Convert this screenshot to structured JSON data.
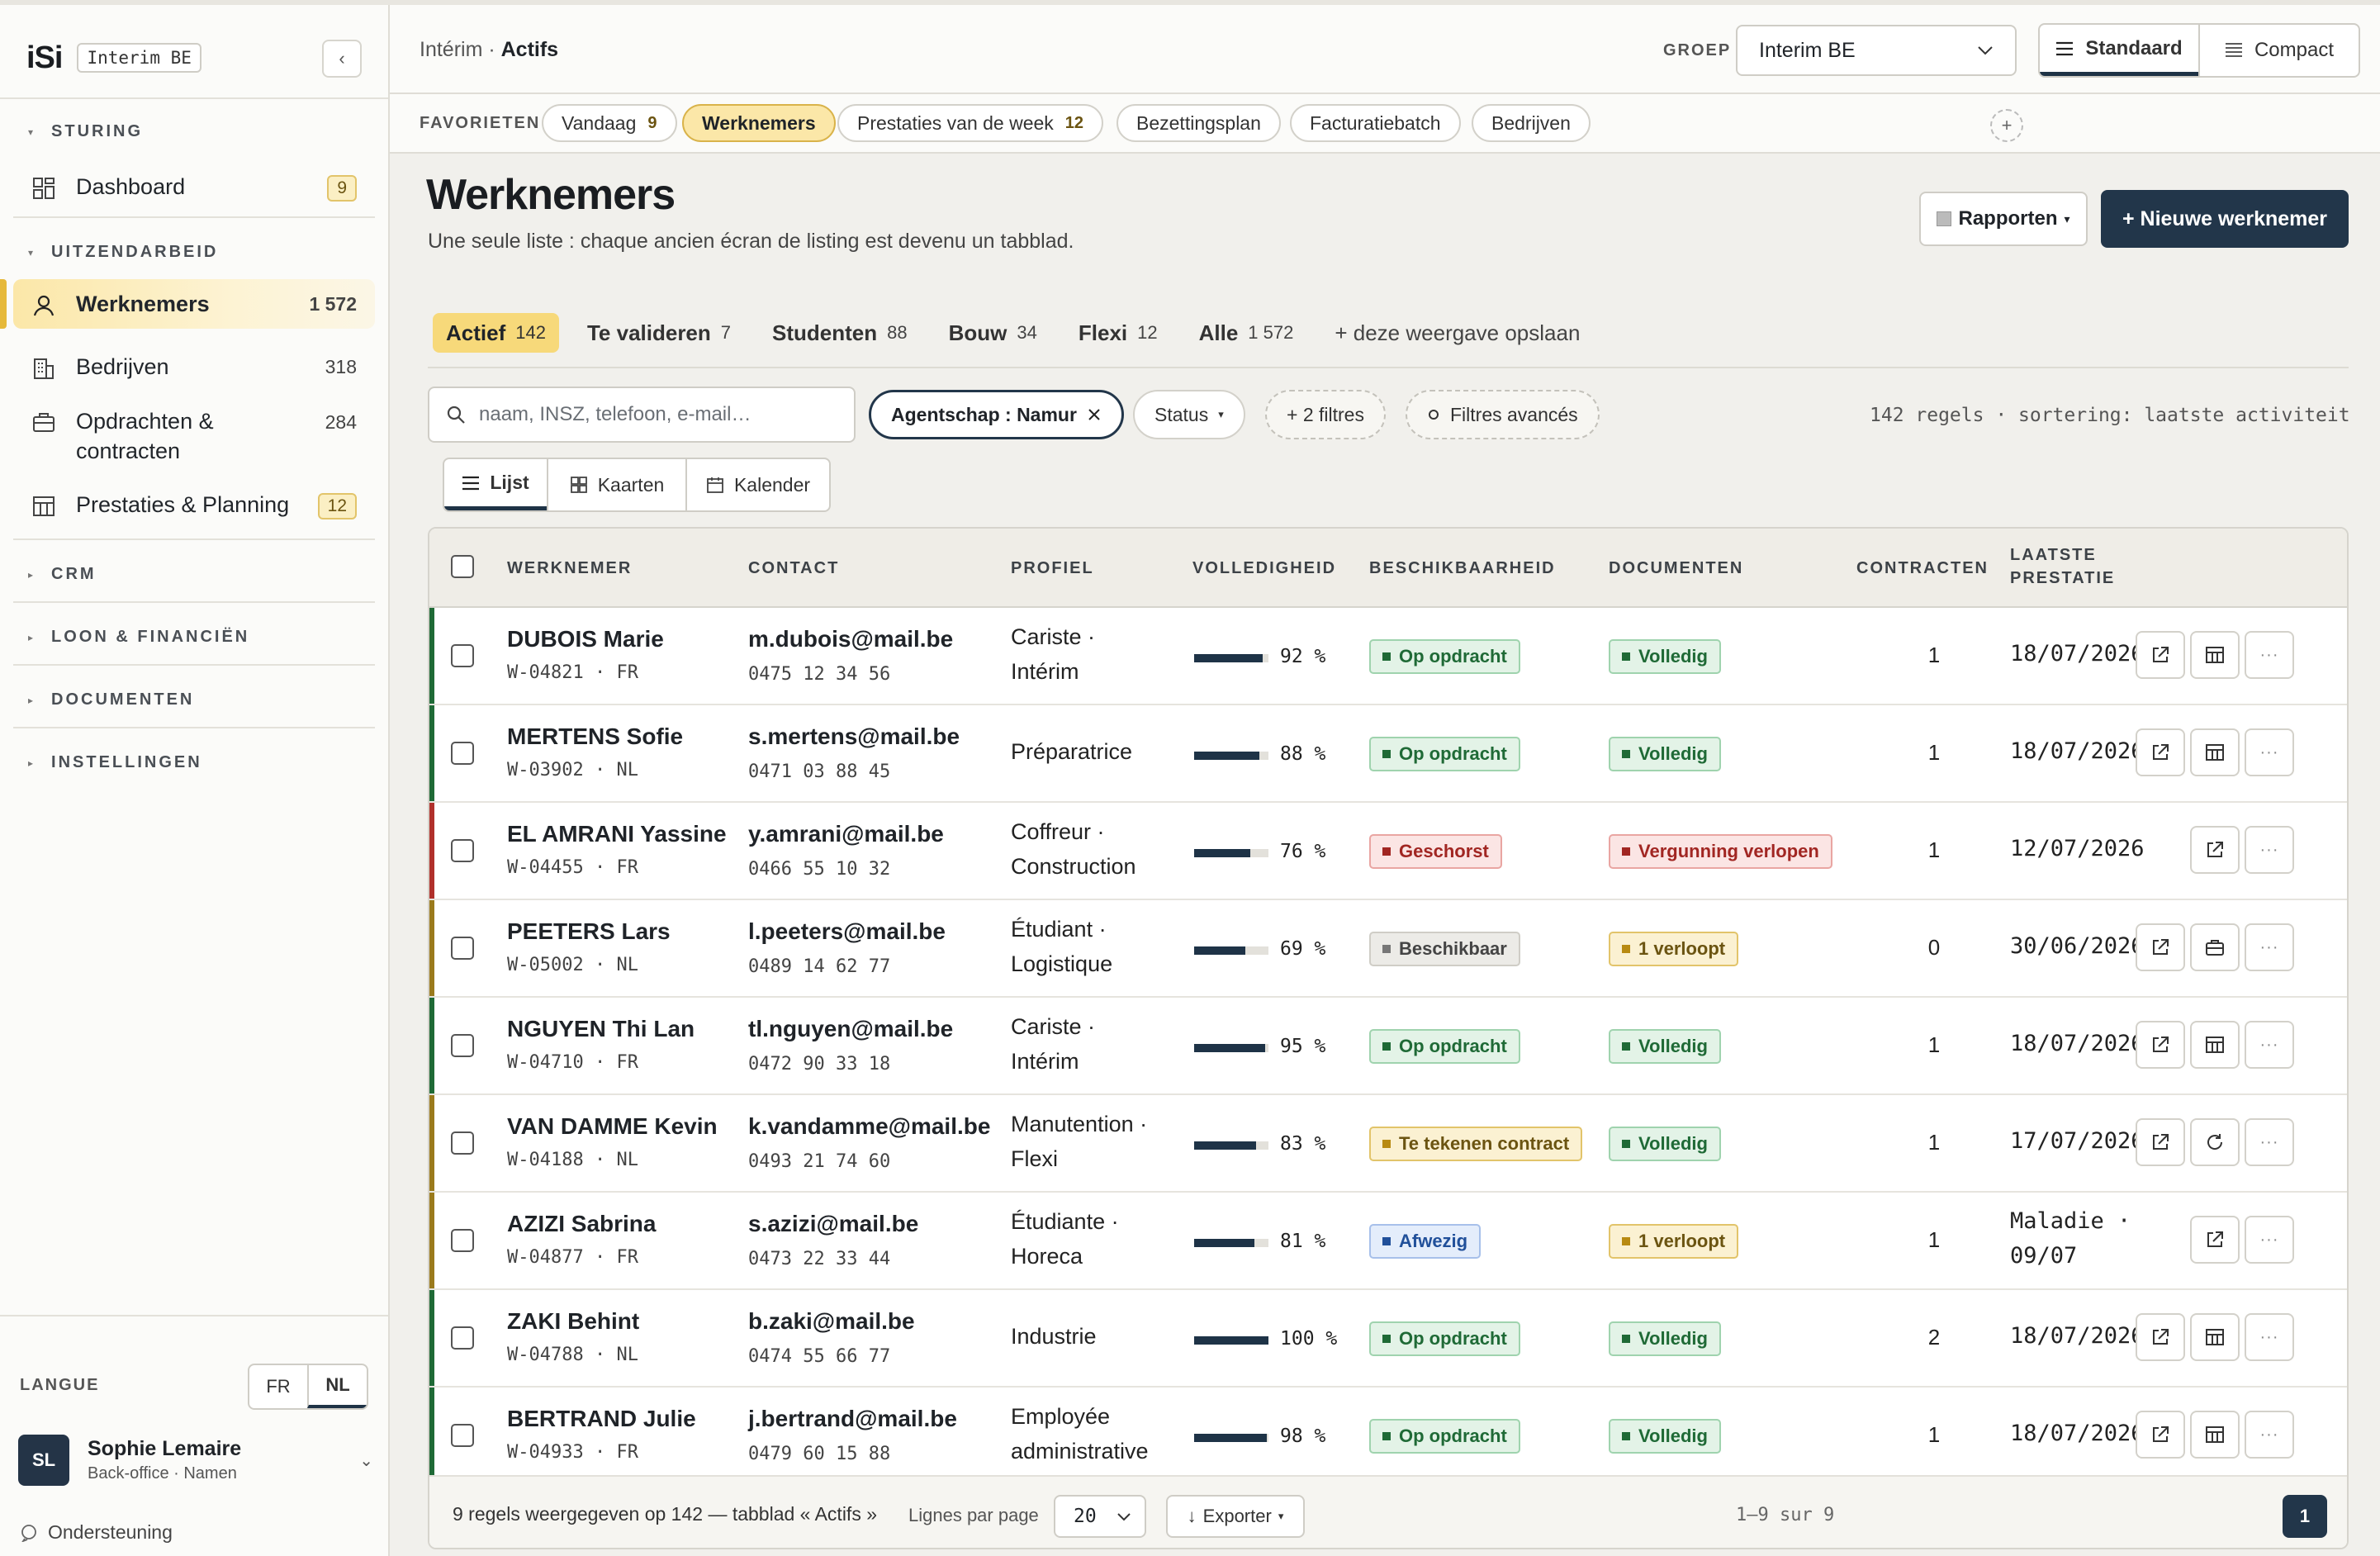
{
  "sidebar": {
    "logo": "iSi",
    "tenant": "Interim BE",
    "collapse_icon": "‹",
    "sections": {
      "sturing": "STURING",
      "uitzendarbeid": "UITZENDARBEID",
      "crm": "CRM",
      "loon": "LOON & FINANCIËN",
      "documenten": "DOCUMENTEN",
      "instellingen": "INSTELLINGEN"
    },
    "items": [
      {
        "label": "Dashboard",
        "count": "9",
        "icon": "dashboard-icon"
      },
      {
        "label": "Werknemers",
        "count": "1 572",
        "icon": "user-icon"
      },
      {
        "label": "Bedrijven",
        "count": "318",
        "icon": "building-icon"
      },
      {
        "label": "Opdrachten & contracten",
        "count": "284",
        "icon": "briefcase-icon"
      },
      {
        "label": "Prestaties & Planning",
        "count": "12",
        "icon": "table-icon"
      }
    ],
    "lang_label": "LANGUE",
    "lang_options": [
      "FR",
      "NL"
    ],
    "lang_selected": "NL",
    "user": {
      "initials": "SL",
      "name": "Sophie Lemaire",
      "role": "Back-office · Namen"
    },
    "support": "Ondersteuning"
  },
  "topbar": {
    "crumb_parent": "Intérim",
    "crumb_sep": " · ",
    "crumb_current": "Actifs",
    "group_label": "GROEP",
    "group_value": "Interim BE",
    "view_standard": "Standaard",
    "view_compact": "Compact"
  },
  "favorites": {
    "label": "FAVORIETEN",
    "chips": [
      {
        "label": "Vandaag",
        "count": "9"
      },
      {
        "label": "Werknemers",
        "count": ""
      },
      {
        "label": "Prestaties van de week",
        "count": "12"
      },
      {
        "label": "Bezettingsplan",
        "count": ""
      },
      {
        "label": "Facturatiebatch",
        "count": ""
      },
      {
        "label": "Bedrijven",
        "count": ""
      }
    ],
    "add": "+"
  },
  "page": {
    "title": "Werknemers",
    "subtitle": "Une seule liste : chaque ancien écran de listing est devenu un tabblad.",
    "reports_label": "Rapporten",
    "reports_caret": "▾",
    "new_label": "+ Nieuwe werknemer"
  },
  "tabs": [
    {
      "label": "Actief",
      "count": "142"
    },
    {
      "label": "Te valideren",
      "count": "7"
    },
    {
      "label": "Studenten",
      "count": "88"
    },
    {
      "label": "Bouw",
      "count": "34"
    },
    {
      "label": "Flexi",
      "count": "12"
    },
    {
      "label": "Alle",
      "count": "1 572"
    }
  ],
  "tab_save": "+ deze weergave opslaan",
  "filters": {
    "search_placeholder": "naam, INSZ, telefoon, e-mail…",
    "agency_chip": "Agentschap : Namur",
    "status_chip": "Status",
    "status_caret": "▾",
    "more_chip": "+ 2 filtres",
    "advanced_chip": "Filtres avancés",
    "meta": "142 regels · sortering: laatste activiteit"
  },
  "layouts": [
    "Lijst",
    "Kaarten",
    "Kalender"
  ],
  "table": {
    "headers": {
      "employee": "WERKNEMER",
      "contact": "CONTACT",
      "profile": "PROFIEL",
      "completeness": "VOLLEDIGHEID",
      "availability": "BESCHIKBAARHEID",
      "documents": "DOCUMENTEN",
      "contracts": "CONTRACTEN",
      "last_1": "LAATSTE",
      "last_2": "PRESTATIE"
    },
    "rows": [
      {
        "name": "DUBOIS Marie",
        "id": "W-04821 · FR",
        "email": "m.dubois@mail.be",
        "phone": "0475 12 34 56",
        "profile_1": "Cariste ·",
        "profile_2": "Intérim",
        "pct": 92,
        "pct_label": "92 %",
        "avail": "Op opdracht",
        "avail_tone": "green",
        "docs": "Volledig",
        "docs_tone": "green",
        "contracts": "1",
        "last_1": "18/07/2026",
        "last_2": "",
        "accent": "#1f6a36",
        "actions": [
          "open",
          "table",
          "more"
        ]
      },
      {
        "name": "MERTENS Sofie",
        "id": "W-03902 · NL",
        "email": "s.mertens@mail.be",
        "phone": "0471 03 88 45",
        "profile_1": "Préparatrice",
        "profile_2": "",
        "pct": 88,
        "pct_label": "88 %",
        "avail": "Op opdracht",
        "avail_tone": "green",
        "docs": "Volledig",
        "docs_tone": "green",
        "contracts": "1",
        "last_1": "18/07/2026",
        "last_2": "",
        "accent": "#1f6a36",
        "actions": [
          "open",
          "table",
          "more"
        ]
      },
      {
        "name": "EL AMRANI Yassine",
        "id": "W-04455 · FR",
        "email": "y.amrani@mail.be",
        "phone": "0466 55 10 32",
        "profile_1": "Coffreur ·",
        "profile_2": "Construction",
        "pct": 76,
        "pct_label": "76 %",
        "avail": "Geschorst",
        "avail_tone": "red",
        "docs": "Vergunning verlopen",
        "docs_tone": "red",
        "contracts": "1",
        "last_1": "12/07/2026",
        "last_2": "",
        "accent": "#b0302b",
        "actions": [
          "open",
          "more"
        ]
      },
      {
        "name": "PEETERS Lars",
        "id": "W-05002 · NL",
        "email": "l.peeters@mail.be",
        "phone": "0489 14 62 77",
        "profile_1": "Étudiant ·",
        "profile_2": "Logistique",
        "pct": 69,
        "pct_label": "69 %",
        "avail": "Beschikbaar",
        "avail_tone": "grey",
        "docs": "1 verloopt",
        "docs_tone": "yellow",
        "contracts": "0",
        "last_1": "30/06/2026",
        "last_2": "",
        "accent": "#9a7a1c",
        "actions": [
          "open",
          "briefcase",
          "more"
        ]
      },
      {
        "name": "NGUYEN Thi Lan",
        "id": "W-04710 · FR",
        "email": "tl.nguyen@mail.be",
        "phone": "0472 90 33 18",
        "profile_1": "Cariste ·",
        "profile_2": "Intérim",
        "pct": 95,
        "pct_label": "95 %",
        "avail": "Op opdracht",
        "avail_tone": "green",
        "docs": "Volledig",
        "docs_tone": "green",
        "contracts": "1",
        "last_1": "18/07/2026",
        "last_2": "",
        "accent": "#1f6a36",
        "actions": [
          "open",
          "table",
          "more"
        ]
      },
      {
        "name": "VAN DAMME Kevin",
        "id": "W-04188 · NL",
        "email": "k.vandamme@mail.be",
        "phone": "0493 21 74 60",
        "profile_1": "Manutention ·",
        "profile_2": "Flexi",
        "pct": 83,
        "pct_label": "83 %",
        "avail": "Te tekenen contract",
        "avail_tone": "yellow",
        "docs": "Volledig",
        "docs_tone": "green",
        "contracts": "1",
        "last_1": "17/07/2026",
        "last_2": "",
        "accent": "#9a7a1c",
        "actions": [
          "open",
          "refresh",
          "more"
        ]
      },
      {
        "name": "AZIZI Sabrina",
        "id": "W-04877 · FR",
        "email": "s.azizi@mail.be",
        "phone": "0473 22 33 44",
        "profile_1": "Étudiante ·",
        "profile_2": "Horeca",
        "pct": 81,
        "pct_label": "81 %",
        "avail": "Afwezig",
        "avail_tone": "blue",
        "docs": "1 verloopt",
        "docs_tone": "yellow",
        "contracts": "1",
        "last_1": "Maladie ·",
        "last_2": "09/07",
        "accent": "#9a7a1c",
        "actions": [
          "open",
          "more"
        ]
      },
      {
        "name": "ZAKI Behint",
        "id": "W-04788 · NL",
        "email": "b.zaki@mail.be",
        "phone": "0474 55 66 77",
        "profile_1": "Industrie",
        "profile_2": "",
        "pct": 100,
        "pct_label": "100 %",
        "avail": "Op opdracht",
        "avail_tone": "green",
        "docs": "Volledig",
        "docs_tone": "green",
        "contracts": "2",
        "last_1": "18/07/2026",
        "last_2": "",
        "accent": "#1f6a36",
        "actions": [
          "open",
          "table",
          "more"
        ]
      },
      {
        "name": "BERTRAND Julie",
        "id": "W-04933 · FR",
        "email": "j.bertrand@mail.be",
        "phone": "0479 60 15 88",
        "profile_1": "Employée",
        "profile_2": "administrative",
        "pct": 98,
        "pct_label": "98 %",
        "avail": "Op opdracht",
        "avail_tone": "green",
        "docs": "Volledig",
        "docs_tone": "green",
        "contracts": "1",
        "last_1": "18/07/2026",
        "last_2": "",
        "accent": "#1f6a36",
        "actions": [
          "open",
          "table",
          "more"
        ]
      }
    ]
  },
  "footer": {
    "summary": "9 regels weergegeven op 142 — tabblad « Actifs »",
    "lines_label": "Lignes par page",
    "lines_value": "20",
    "export_label": "Exporter",
    "export_caret": "▾",
    "range": "1–9 sur 9",
    "page": "1"
  }
}
